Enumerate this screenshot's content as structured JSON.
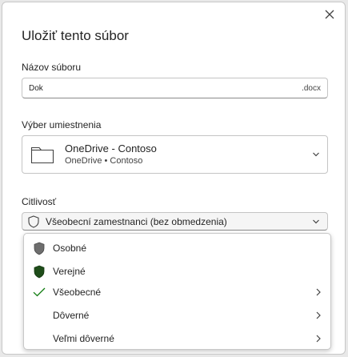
{
  "dialog": {
    "title": "Uložiť tento súbor",
    "close_icon": "close-icon"
  },
  "filename": {
    "label": "Názov súboru",
    "value": "Dok",
    "extension": ".docx"
  },
  "location": {
    "label": "Výber umiestnenia",
    "name": "OneDrive - Contoso",
    "subtitle": "OneDrive • Contoso",
    "icon": "folder-icon"
  },
  "sensitivity": {
    "label": "Citlivosť",
    "selected": "Všeobecní zamestnanci (bez obmedzenia)",
    "icon": "shield-outline-icon"
  },
  "menu": {
    "items": [
      {
        "label": "Osobné",
        "icon": "shield-gray-icon",
        "color": "#6e6e6e",
        "has_submenu": false
      },
      {
        "label": "Verejné",
        "icon": "shield-green-icon",
        "color": "#1f4d1a",
        "has_submenu": false
      },
      {
        "label": "Všeobecné",
        "icon": "checkmark-icon",
        "color": "#107c10",
        "has_submenu": true
      },
      {
        "label": "Dôverné",
        "icon": "",
        "has_submenu": true
      },
      {
        "label": "Veľmi dôverné",
        "icon": "",
        "has_submenu": true
      }
    ]
  }
}
